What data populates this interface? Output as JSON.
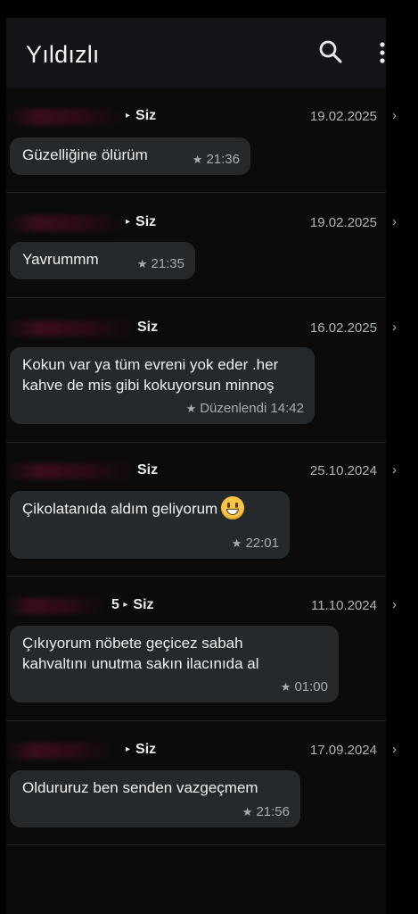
{
  "header": {
    "title": "Yıldızlı"
  },
  "icons": {
    "search": "search-icon",
    "more": "more-vertical-icon",
    "star": "star-icon",
    "chevron": "chevron-right-icon",
    "emoji": "grinning-face-emoji-icon"
  },
  "messages": [
    {
      "sender_suffix": "Siz",
      "date": "19.02.2025",
      "text": "Güzelliğine ölürüm",
      "status": "",
      "time": "21:36"
    },
    {
      "sender_suffix": "Siz",
      "date": "19.02.2025",
      "text": "Yavrummm",
      "status": "",
      "time": "21:35"
    },
    {
      "sender_suffix": "Siz",
      "date": "16.02.2025",
      "text": "Kokun var ya tüm evreni yok eder .her kahve de mis gibi kokuyorsun minnoş",
      "status": "Düzenlendi",
      "time": "14:42"
    },
    {
      "sender_suffix": "Siz",
      "date": "25.10.2024",
      "text": "Çikolatanıda aldım geliyorum",
      "status": "",
      "time": "22:01"
    },
    {
      "sender_prefix": "5",
      "sender_suffix": "Siz",
      "date": "11.10.2024",
      "text": "Çıkıyorum nöbete geçicez sabah kahvaltını unutma sakın ilacınıda al",
      "status": "",
      "time": "01:00"
    },
    {
      "sender_suffix": "Siz",
      "date": "17.09.2024",
      "text": "Oldururuz ben senden vazgeçmem",
      "status": "",
      "time": "21:56"
    }
  ]
}
